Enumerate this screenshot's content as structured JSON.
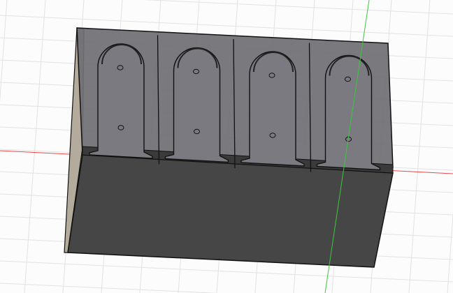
{
  "viewport": {
    "colors": {
      "background": "#fcfcfc",
      "grid": "#e2e2e2",
      "x_axis": "#e8484a",
      "y_axis": "#3cc83c",
      "top_face": "#75757a",
      "front_face": "#464646",
      "side_face": "#b3ab9c",
      "edge": "#111111"
    },
    "slot_count": 4
  }
}
